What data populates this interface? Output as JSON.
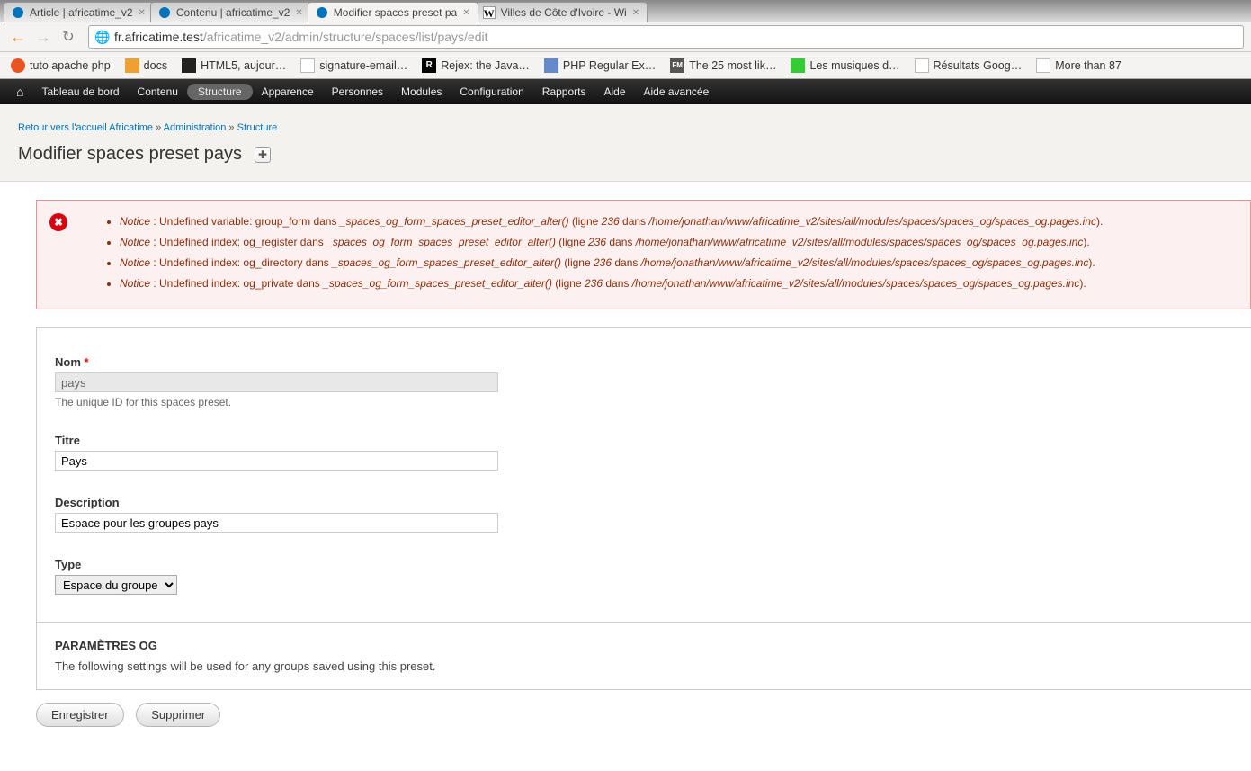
{
  "tabs": [
    {
      "title": "Article | africatime_v2",
      "icon": "drupal"
    },
    {
      "title": "Contenu | africatime_v2",
      "icon": "drupal"
    },
    {
      "title": "Modifier spaces preset pa",
      "icon": "drupal",
      "active": true
    },
    {
      "title": "Villes de Côte d'Ivoire - Wi",
      "icon": "wiki"
    }
  ],
  "url": {
    "host": "fr.africatime.test",
    "path": "/africatime_v2/admin/structure/spaces/list/pays/edit"
  },
  "bookmarks": [
    {
      "label": "tuto apache php",
      "icon": "ubuntu"
    },
    {
      "label": "docs",
      "icon": "folder"
    },
    {
      "label": "HTML5, aujour…",
      "icon": "dark"
    },
    {
      "label": "signature-email…",
      "icon": "page"
    },
    {
      "label": "Rejex: the Java…",
      "icon": "R"
    },
    {
      "label": "PHP Regular Ex…",
      "icon": "php"
    },
    {
      "label": "The 25 most lik…",
      "icon": "FM"
    },
    {
      "label": "Les musiques d…",
      "icon": "green"
    },
    {
      "label": "Résultats Goog…",
      "icon": "page"
    },
    {
      "label": "More than 87",
      "icon": "page"
    }
  ],
  "admin_menu": {
    "items": [
      "Tableau de bord",
      "Contenu",
      "Structure",
      "Apparence",
      "Personnes",
      "Modules",
      "Configuration",
      "Rapports",
      "Aide",
      "Aide avancée"
    ],
    "active": "Structure"
  },
  "breadcrumb": {
    "home": "Retour vers l'accueil Africatime",
    "admin": "Administration",
    "structure": "Structure"
  },
  "page_title": "Modifier spaces preset pays",
  "errors": [
    {
      "level": "Notice",
      "msg": "Undefined variable: group_form dans ",
      "fn": "_spaces_og_form_spaces_preset_editor_alter()",
      "line": "236",
      "file": "/home/jonathan/www/africatime_v2/sites/all/modules/spaces/spaces_og/spaces_og.pages.inc"
    },
    {
      "level": "Notice",
      "msg": "Undefined index: og_register dans ",
      "fn": "_spaces_og_form_spaces_preset_editor_alter()",
      "line": "236",
      "file": "/home/jonathan/www/africatime_v2/sites/all/modules/spaces/spaces_og/spaces_og.pages.inc"
    },
    {
      "level": "Notice",
      "msg": "Undefined index: og_directory dans ",
      "fn": "_spaces_og_form_spaces_preset_editor_alter()",
      "line": "236",
      "file": "/home/jonathan/www/africatime_v2/sites/all/modules/spaces/spaces_og/spaces_og.pages.inc"
    },
    {
      "level": "Notice",
      "msg": "Undefined index: og_private dans ",
      "fn": "_spaces_og_form_spaces_preset_editor_alter()",
      "line": "236",
      "file": "/home/jonathan/www/africatime_v2/sites/all/modules/spaces/spaces_og/spaces_og.pages.inc"
    }
  ],
  "error_common": {
    "ligne_label": "ligne",
    "dans_label": "dans"
  },
  "form": {
    "nom": {
      "label": "Nom",
      "required": "*",
      "value": "pays",
      "desc": "The unique ID for this spaces preset."
    },
    "titre": {
      "label": "Titre",
      "value": "Pays"
    },
    "description": {
      "label": "Description",
      "value": "Espace pour les groupes pays"
    },
    "type": {
      "label": "Type",
      "selected": "Espace du groupe"
    }
  },
  "og": {
    "heading": "PARAMÈTRES OG",
    "desc": "The following settings will be used for any groups saved using this preset."
  },
  "actions": {
    "save": "Enregistrer",
    "delete": "Supprimer"
  }
}
